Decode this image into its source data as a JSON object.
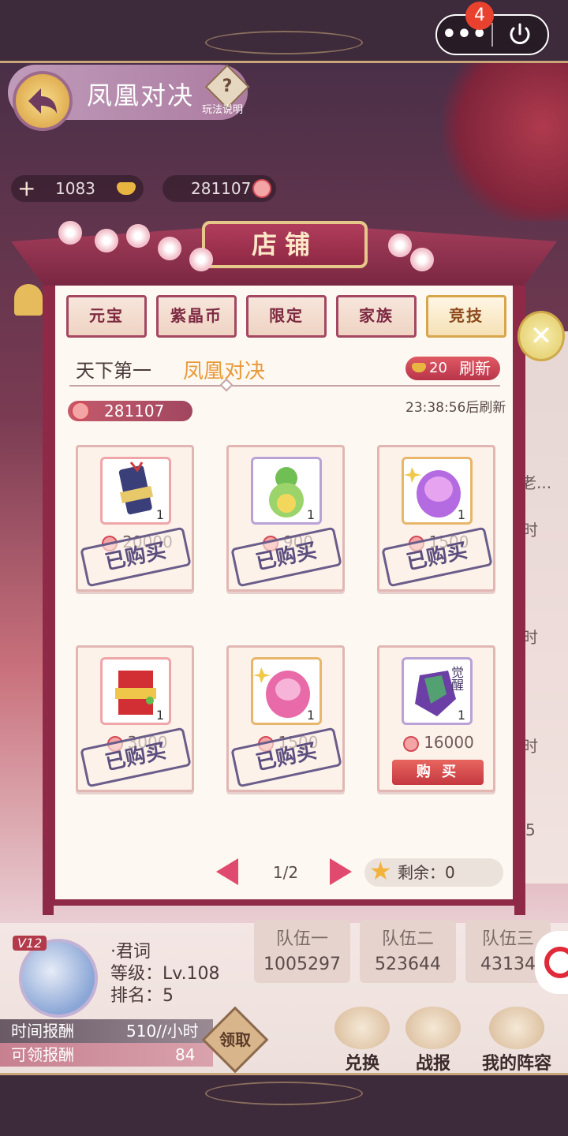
{
  "system": {
    "badge_count": "4",
    "more_label": "•••"
  },
  "header": {
    "title": "凤凰对决",
    "help_label": "玩法说明",
    "help_icon": "?"
  },
  "resources": {
    "ingot": "1083",
    "coin": "281107"
  },
  "shop": {
    "title": "店铺",
    "tabs": [
      {
        "label": "元宝",
        "active": false
      },
      {
        "label": "紫晶币",
        "active": false
      },
      {
        "label": "限定",
        "active": false
      },
      {
        "label": "家族",
        "active": false
      },
      {
        "label": "竞技",
        "active": true
      }
    ],
    "subnav": [
      "天下第一",
      "凤凰对决"
    ],
    "refresh_cost": "20",
    "refresh_label": "刷新",
    "balance": "281107",
    "refresh_timer": "23:38:56后刷新",
    "items": [
      {
        "name": "scroll-item",
        "qty": "1",
        "price": "20000",
        "purchased": true,
        "stamp": "已购买"
      },
      {
        "name": "gourd-item",
        "qty": "1",
        "price": "900",
        "purchased": true,
        "stamp": "已购买"
      },
      {
        "name": "purple-gem-item",
        "qty": "1",
        "price": "1500",
        "purchased": true,
        "stamp": "已购买"
      },
      {
        "name": "red-envelope-item",
        "qty": "1",
        "price": "3000",
        "purchased": true,
        "stamp": "已购买"
      },
      {
        "name": "pink-gem-item",
        "qty": "1",
        "price": "1500",
        "purchased": true,
        "stamp": "已购买"
      },
      {
        "name": "awaken-crystal-item",
        "qty": "1",
        "price": "16000",
        "purchased": false,
        "buy_label": "购 买",
        "overlay_text": "觉醒"
      }
    ],
    "page": "1/2",
    "remaining": "剩余：0"
  },
  "player": {
    "vip": "V12",
    "name": "·君词",
    "level": "等级：Lv.108",
    "rank": "排名：5",
    "time_reward_label": "时间报酬",
    "time_reward_value": "510//小时",
    "claimable_label": "可领报酬",
    "claimable_value": "84",
    "claim_label": "领取"
  },
  "teams": [
    {
      "label": "队伍一",
      "value": "1005297"
    },
    {
      "label": "队伍二",
      "value": "523644"
    },
    {
      "label": "队伍三",
      "value": "43134"
    }
  ],
  "actions": [
    "兑换",
    "战报",
    "我的阵容"
  ],
  "side": {
    "texts": [
      "老...",
      "时",
      "时",
      "时",
      "5"
    ]
  },
  "colors": {
    "accent": "#8e2a47",
    "highlight": "#e89a3a"
  }
}
